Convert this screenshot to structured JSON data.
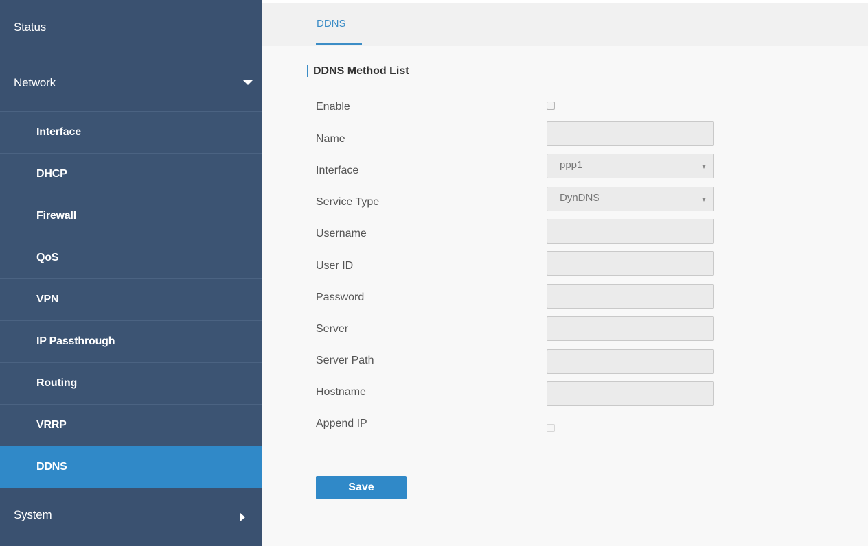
{
  "sidebar": {
    "status": "Status",
    "network": "Network",
    "items": [
      {
        "label": "Interface"
      },
      {
        "label": "DHCP"
      },
      {
        "label": "Firewall"
      },
      {
        "label": "QoS"
      },
      {
        "label": "VPN"
      },
      {
        "label": "IP Passthrough"
      },
      {
        "label": "Routing"
      },
      {
        "label": "VRRP"
      },
      {
        "label": "DDNS"
      }
    ],
    "system": "System"
  },
  "tabs": [
    {
      "label": "DDNS"
    }
  ],
  "section": {
    "title": "DDNS Method List"
  },
  "form": {
    "enable_label": "Enable",
    "name_label": "Name",
    "name_value": "",
    "interface_label": "Interface",
    "interface_value": "ppp1",
    "service_type_label": "Service Type",
    "service_type_value": "DynDNS",
    "username_label": "Username",
    "username_value": "",
    "userid_label": "User ID",
    "userid_value": "",
    "password_label": "Password",
    "password_value": "",
    "server_label": "Server",
    "server_value": "",
    "server_path_label": "Server Path",
    "server_path_value": "",
    "hostname_label": "Hostname",
    "hostname_value": "",
    "append_ip_label": "Append IP",
    "save_label": "Save"
  },
  "colors": {
    "sidebar_bg": "#3c5473",
    "active": "#3089c8",
    "accent": "#3c8dc6"
  }
}
